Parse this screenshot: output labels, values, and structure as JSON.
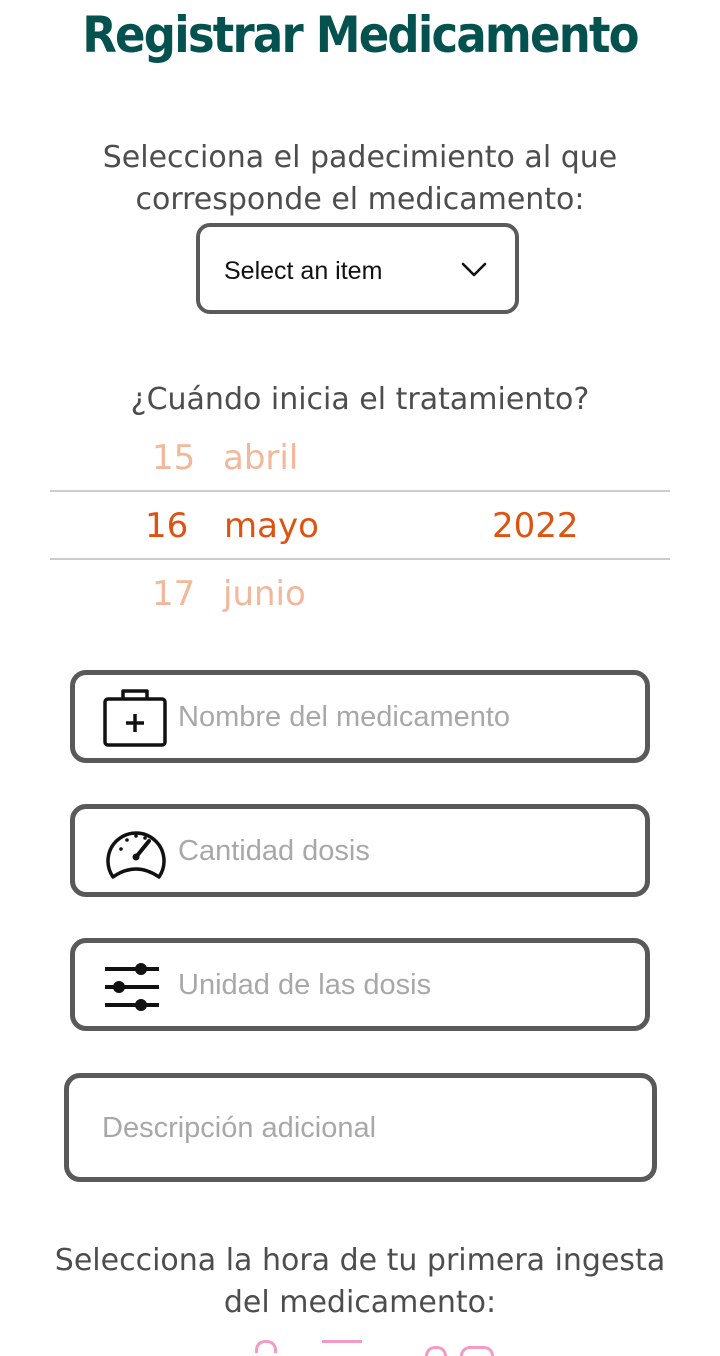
{
  "page": {
    "title": "Registrar Medicamento"
  },
  "condition": {
    "prompt_line1": "Selecciona el padecimiento al que",
    "prompt_line2": "corresponde el medicamento:",
    "dropdown_value": "Select an item"
  },
  "start_date": {
    "prompt": "¿Cuándo inicia el tratamiento?",
    "prev": {
      "day": "15",
      "month": "abril"
    },
    "selected": {
      "day": "16",
      "month": "mayo",
      "year": "2022"
    },
    "next": {
      "day": "17",
      "month": "junio"
    }
  },
  "fields": {
    "medicine_name_placeholder": "Nombre del medicamento",
    "dose_amount_placeholder": "Cantidad dosis",
    "dose_unit_placeholder": "Unidad de las dosis",
    "description_placeholder": "Descripción adicional"
  },
  "first_intake": {
    "prompt_line1": "Selecciona la hora de tu primera ingesta",
    "prompt_line2": "del medicamento:"
  },
  "colors": {
    "title": "#03524f",
    "picker_active": "#e0520f",
    "picker_faded": "#f3b79b",
    "border": "#595959",
    "time_picker": "#f59ac4"
  }
}
